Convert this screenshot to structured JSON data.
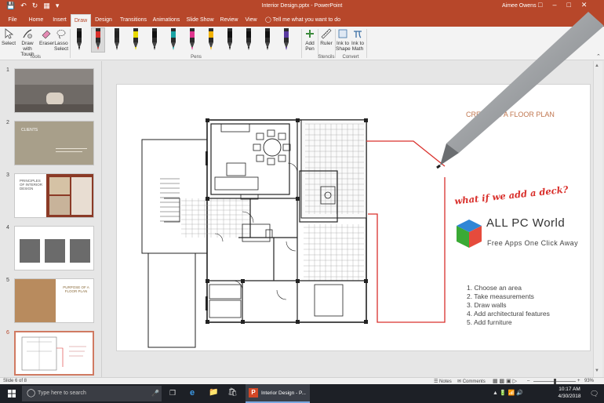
{
  "titlebar": {
    "title": "Interior Design.pptx - PowerPoint",
    "user": "Aimee Owens"
  },
  "tabs": [
    "File",
    "Home",
    "Insert",
    "Draw",
    "Design",
    "Transitions",
    "Animations",
    "Slide Show",
    "Review",
    "View"
  ],
  "tell_me": "Tell me what you want to do",
  "ribbon": {
    "select": "Select",
    "draw_touch": "Draw with Touch",
    "eraser": "Eraser",
    "lasso": "Lasso Select",
    "tools_group": "Tools",
    "pens_group": "Pens",
    "add_pen": "Add Pen",
    "ruler": "Ruler",
    "stencils_group": "Stencils",
    "ink_shape": "Ink to Shape",
    "ink_math": "Ink to Math",
    "convert_group": "Convert",
    "pen_colors": [
      "#111111",
      "#d9302c",
      "#222222",
      "#e8d900",
      "#111111",
      "#1aa3a3",
      "#e0368f",
      "#f2b200",
      "#111111",
      "#111111",
      "#111111",
      "#5a3aa0"
    ]
  },
  "thumbs": {
    "numbers": [
      "1",
      "2",
      "3",
      "4",
      "5",
      "6"
    ],
    "s2_title": "CLIENTS",
    "s3_title": "PRINCIPLES OF INTERIOR DESIGN",
    "s5_title": "PURPOSE OF A FLOOR PLAN"
  },
  "slide": {
    "title": "CREATING A FLOOR PLAN",
    "handwriting": "what if we add a deck?",
    "steps": [
      "1. Choose an area",
      "2. Take measurements",
      "3. Draw walls",
      "4. Add architectural features",
      "5. Add furniture"
    ]
  },
  "watermark": {
    "brand": "ALL PC World",
    "tagline": "Free Apps One Click Away"
  },
  "status": {
    "slide": "Slide 6 of 8",
    "notes": "Notes",
    "comments": "Comments",
    "zoom": "93%"
  },
  "taskbar": {
    "search": "Type here to search",
    "app": "Interior Design - P...",
    "time": "10:17 AM",
    "date": "4/30/2018"
  },
  "colors": {
    "accent": "#b7472a",
    "ink": "#d9302c"
  }
}
